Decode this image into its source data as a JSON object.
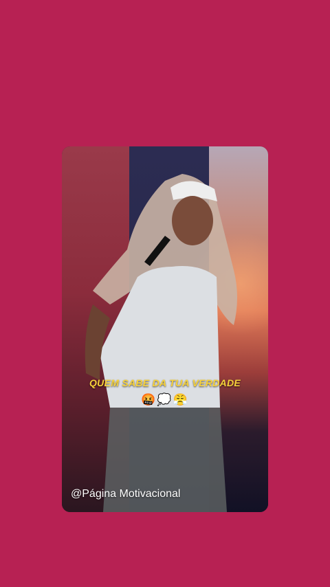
{
  "story": {
    "caption": "QUEM SABE DA TUA VERDADE",
    "emojis": "🤬💭😤",
    "handle": "@Página Motivacional"
  },
  "colors": {
    "background": "#b72153",
    "caption": "#f7d23a"
  }
}
